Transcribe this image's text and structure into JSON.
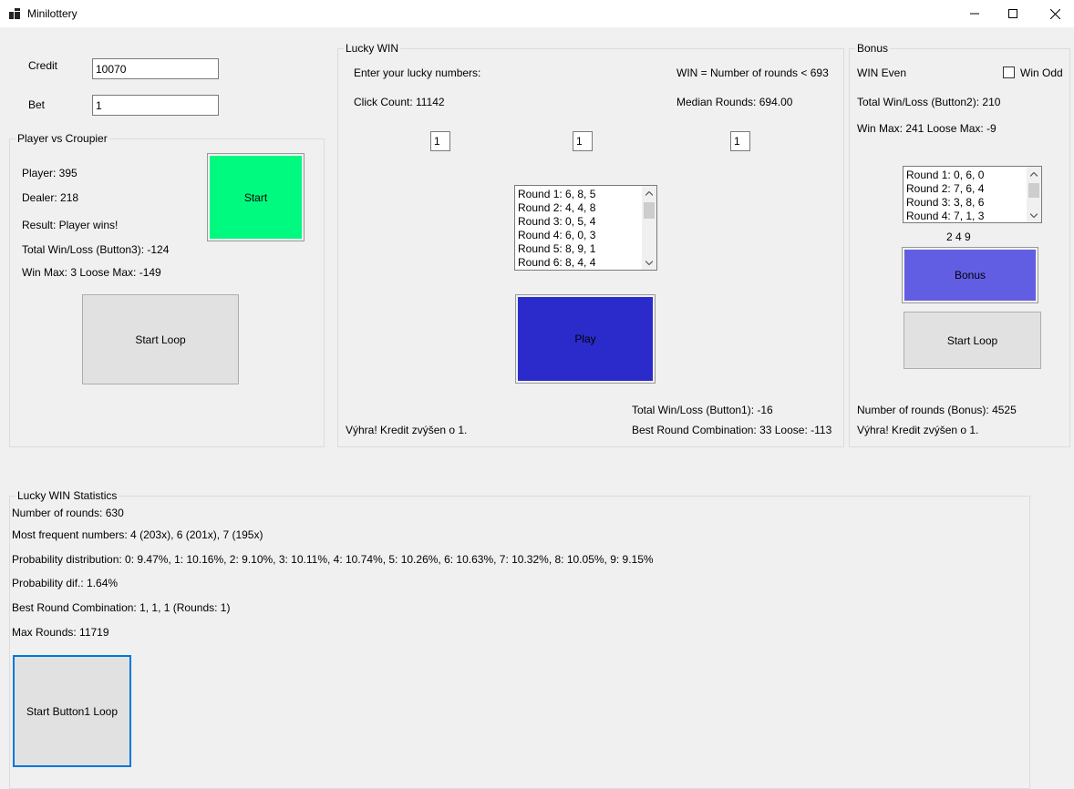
{
  "window": {
    "title": "Minilottery",
    "minimize_icon": "minimize-icon",
    "maximize_icon": "maximize-icon",
    "close_icon": "close-icon"
  },
  "top": {
    "credit_label": "Credit",
    "credit_value": "10070",
    "bet_label": "Bet",
    "bet_value": "1"
  },
  "player_vs_croupier": {
    "title": "Player vs Croupier",
    "player": "Player: 395",
    "dealer": "Dealer: 218",
    "result": "Result: Player wins!",
    "total": "Total Win/Loss (Button3): -124",
    "winmax": "Win Max: 3 Loose Max: -149",
    "start_label": "Start",
    "start_loop_label": "Start Loop",
    "start_color": "#00fa80"
  },
  "lucky_win": {
    "title": "Lucky WIN",
    "enter_label": "Enter your lucky numbers:",
    "win_condition": "WIN = Number of rounds < 693",
    "click_count": "Click Count: 11142",
    "median_rounds": "Median Rounds: 694.00",
    "numbers": [
      "1",
      "1",
      "1"
    ],
    "rounds": [
      "Round 1: 6, 8, 5",
      "Round 2: 4, 4, 8",
      "Round 3: 0, 5, 4",
      "Round 4: 6, 0, 3",
      "Round 5: 8, 9, 1",
      "Round 6: 8, 4, 4"
    ],
    "play_label": "Play",
    "play_color": "#2b2bcc",
    "total": "Total Win/Loss (Button1): -16",
    "best_round": "Best Round Combination: 33 Loose: -113",
    "message": "Výhra! Kredit zvýšen o 1."
  },
  "bonus": {
    "title": "Bonus",
    "win_even": "WIN Even",
    "win_odd": "Win Odd",
    "win_odd_checked": false,
    "total": "Total Win/Loss (Button2): 210",
    "winmax": "Win Max: 241 Loose Max: -9",
    "rounds": [
      "Round 1: 0, 6, 0",
      "Round 2: 7, 6, 4",
      "Round 3: 3, 8, 6",
      "Round 4: 7, 1, 3"
    ],
    "digits": "2 4 9",
    "bonus_label": "Bonus",
    "bonus_color": "#625ee4",
    "start_loop_label": "Start Loop",
    "number_of_rounds": "Number of rounds (Bonus): 4525",
    "message": "Výhra! Kredit zvýšen o 1."
  },
  "statistics": {
    "title": "Lucky WIN Statistics",
    "number_of_rounds": "Number of rounds: 630",
    "most_frequent": "Most frequent numbers: 4 (203x), 6 (201x), 7 (195x)",
    "probability_distribution": "Probability distribution: 0: 9.47%, 1: 10.16%, 2: 9.10%, 3: 10.11%, 4: 10.74%, 5: 10.26%, 6: 10.63%, 7: 10.32%, 8: 10.05%, 9: 9.15%",
    "probability_dif": "Probability dif.: 1.64%",
    "best_round": "Best Round Combination: 1, 1, 1 (Rounds: 1)",
    "max_rounds": "Max Rounds: 11719",
    "start_loop_label": "Start Button1 Loop",
    "focus_color": "#0078d7"
  }
}
